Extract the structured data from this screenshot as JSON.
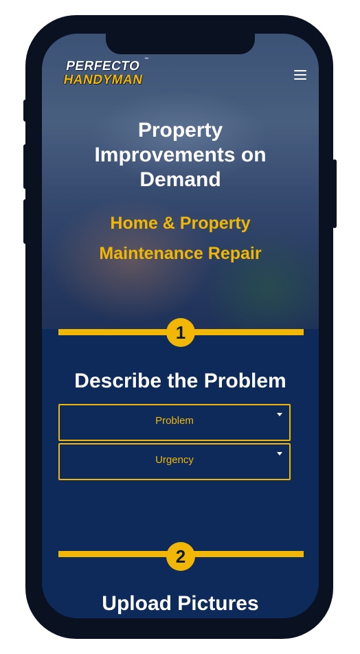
{
  "brand": {
    "logo_top": "PERFECTO",
    "logo_bottom": "HANDYMAN",
    "logo_tm": "™",
    "accent_color": "#f2b705",
    "primary_color": "#0d2a5a"
  },
  "header": {
    "menu_icon": "hamburger-menu-icon"
  },
  "hero": {
    "title": "Property Improvements on Demand",
    "subtitle": "Home & Property Maintenance Repair"
  },
  "steps": [
    {
      "number": "1",
      "title": "Describe the Problem",
      "fields": [
        {
          "selected": "Problem"
        },
        {
          "selected": "Urgency"
        }
      ]
    },
    {
      "number": "2",
      "title": "Upload Pictures"
    }
  ]
}
